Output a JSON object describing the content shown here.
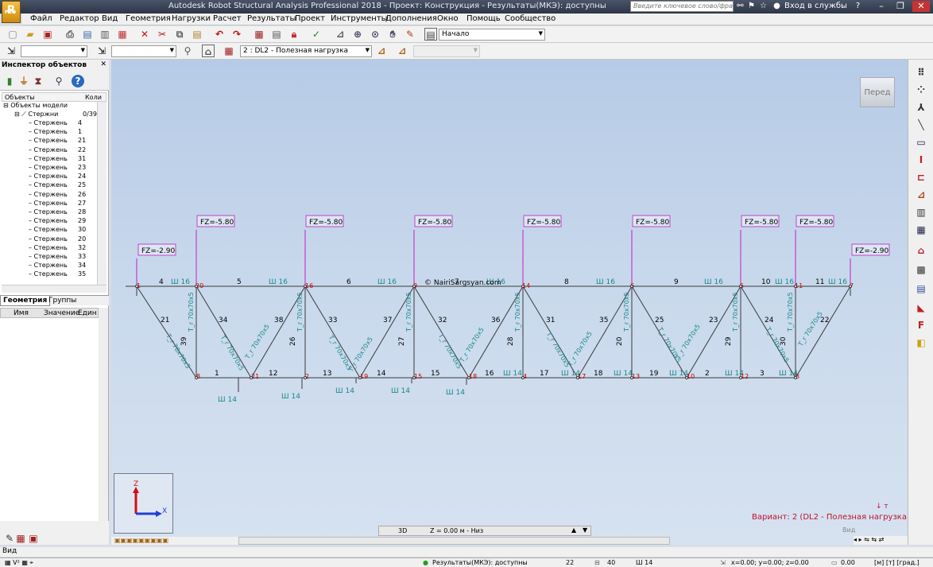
{
  "app": {
    "title": "Autodesk Robot Structural Analysis Professional 2018 - Проект: Конструкция - Результаты(МКЭ): доступны",
    "logo": "R",
    "logo_sub": "PRO",
    "search_placeholder": "Введите ключевое слово/фразу",
    "login": "Вход в службы"
  },
  "menu": [
    "Файл",
    "Редактор",
    "Вид",
    "Геометрия",
    "Нагрузки",
    "Расчет",
    "Результаты",
    "Проект",
    "Инструменты",
    "Дополнения",
    "Окно",
    "Помощь",
    "Сообщество"
  ],
  "toolbar": {
    "layout_combo": "Начало",
    "load_case_combo": "2 : DL2 - Полезная нагрузка"
  },
  "inspector": {
    "title": "Инспектор объектов",
    "col_objects": "Объекты",
    "col_count": "Коли",
    "model_objects": "Объекты модели",
    "bars_label": "Стержни",
    "bars_count": "0/39",
    "bar_label": "Стержень",
    "bar_ids": [
      "4",
      "1",
      "21",
      "22",
      "31",
      "23",
      "24",
      "25",
      "26",
      "27",
      "28",
      "29",
      "30",
      "20",
      "32",
      "33",
      "34",
      "35"
    ],
    "tab_geometry": "Геометрия",
    "tab_groups": "Группы",
    "prop_name": "Имя",
    "prop_value": "Значение",
    "prop_unit": "Един"
  },
  "viewport": {
    "pered": "Перед",
    "variant": "Вариант: 2 (DL2 - Полезная нагрузка)",
    "watermark": "© NairiSargsyan.com",
    "axis_z": "Z",
    "axis_x": "X"
  },
  "chart_data": {
    "loads": [
      "FZ=-2.90",
      "FZ=-5.80",
      "FZ=-5.80",
      "FZ=-5.80",
      "FZ=-5.80",
      "FZ=-5.80",
      "FZ=-5.80",
      "FZ=-5.80",
      "FZ=-2.90"
    ],
    "top_bar_ids": [
      "4",
      "5",
      "6",
      "7",
      "8",
      "9",
      "10",
      "11"
    ],
    "bottom_bar_ids": [
      "1",
      "12",
      "13",
      "14",
      "15",
      "16",
      "17",
      "18",
      "19",
      "2",
      "3"
    ],
    "vertical_bar_ids": [
      "39",
      "26",
      "27",
      "28",
      "20",
      "29",
      "30"
    ],
    "diagonal_bar_ids": [
      "21",
      "34",
      "38",
      "33",
      "37",
      "32",
      "36",
      "31",
      "35",
      "25",
      "23",
      "24",
      "22"
    ],
    "top_node_ids": [
      "1",
      "20",
      "16",
      "9",
      "14",
      "6",
      "5",
      "11",
      "7"
    ],
    "bottom_node_ids": [
      "8",
      "21",
      "2",
      "19",
      "15",
      "18",
      "4",
      "17",
      "13",
      "10",
      "12",
      "3"
    ],
    "section_top": "Ш 16",
    "section_bottom": "Ш 14",
    "section_web": "T_r 70x70x5"
  },
  "bottom": {
    "view_3d": "3D",
    "z_level": "Z = 0.00 м - Низ",
    "vid": "Вид",
    "vid_right": "Вид"
  },
  "status": {
    "results": "Результаты(МКЭ): доступны",
    "n1": "22",
    "n2": "40",
    "section": "Ш 14",
    "coords": "x=0.00; y=0.00; z=0.00",
    "value": "0.00",
    "units": "[м] [т] [град.]"
  }
}
